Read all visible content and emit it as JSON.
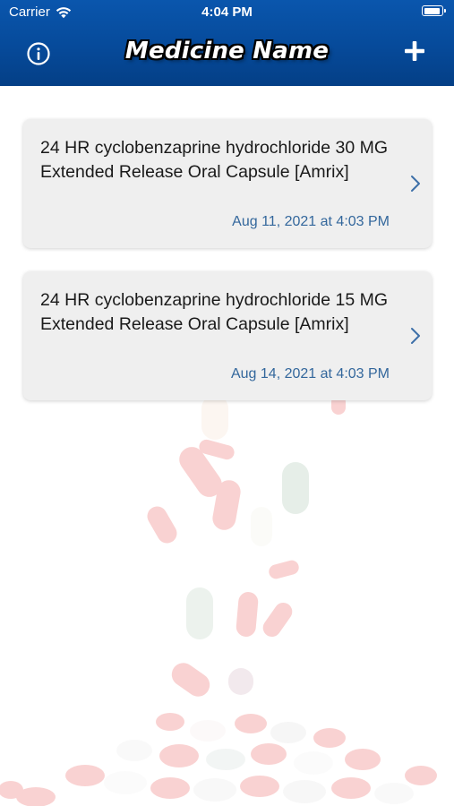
{
  "status_bar": {
    "carrier": "Carrier",
    "time": "4:04 PM",
    "icons": [
      "wifi-icon",
      "battery-icon"
    ]
  },
  "nav": {
    "title": "Medicine Name",
    "left_icon": "info-icon",
    "right_icon": "plus-icon"
  },
  "colors": {
    "header_blue": "#064a9a",
    "card_background": "#efefef",
    "date_text": "#33679c",
    "chevron": "#3d6fa8"
  },
  "medicines": [
    {
      "name": "24 HR cyclobenzaprine hydrochloride 30 MG Extended Release Oral Capsule [Amrix]",
      "date": "Aug 11, 2021 at 4:03 PM"
    },
    {
      "name": "24 HR cyclobenzaprine hydrochloride 15 MG Extended Release Oral Capsule [Amrix]",
      "date": "Aug 14, 2021 at 4:03 PM"
    }
  ]
}
